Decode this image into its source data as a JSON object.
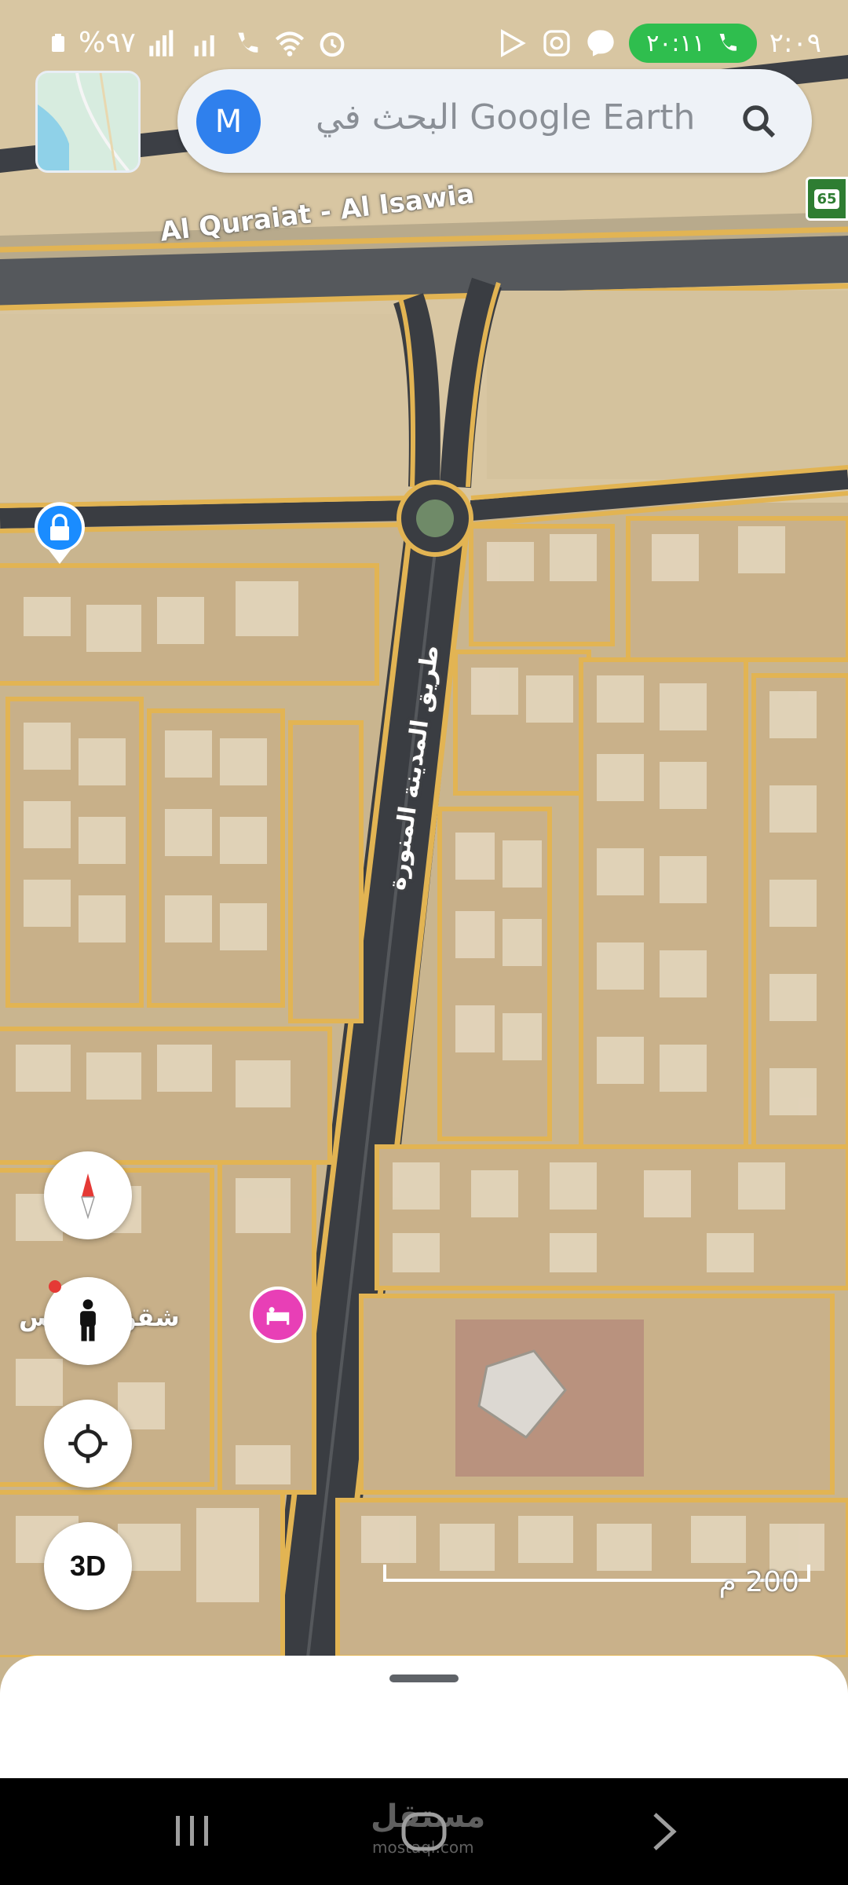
{
  "status_bar": {
    "battery": "%٩٧",
    "clock": "٢:٠٩",
    "call_timer": "٢٠:١١"
  },
  "search": {
    "avatar_letter": "M",
    "placeholder": "البحث في Google Earth"
  },
  "map": {
    "highway_label": "Al Quraiat - Al Isawia",
    "route_shield": "65",
    "street_label": "طريق المدينة المنورة",
    "poi_label": "شقق برج س"
  },
  "controls": {
    "three_d_label": "3D"
  },
  "scale": {
    "label": "200 م"
  },
  "nav": {
    "watermark": "مستقل",
    "watermark_sub": "mostaql.com"
  },
  "colors": {
    "road_outline": "#e2b453",
    "accent_blue": "#2f80ed",
    "hotel_pin": "#e83fb6",
    "call_green": "#2fbe4e"
  }
}
